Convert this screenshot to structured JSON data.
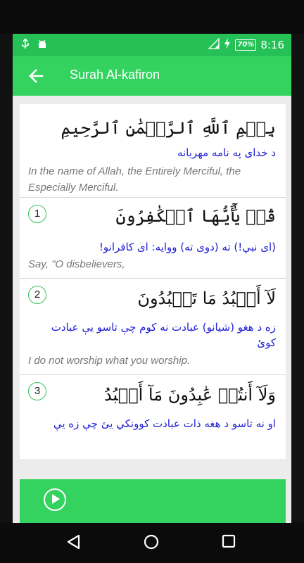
{
  "status_bar": {
    "battery": "70%",
    "time": "8:16"
  },
  "app_bar": {
    "title": "Surah Al-kafiron"
  },
  "bismillah": {
    "arabic": "بِسۡمِ ٱللَّهِ ٱلرَّحۡمَٰنِ ٱلرَّحِيمِ",
    "pashto": "د خدای په نامه مهربانه",
    "english": "In the name of Allah, the Entirely Merciful, the Especially Merciful."
  },
  "verses": [
    {
      "number": "1",
      "arabic": "قُلۡ يَٰٓأَيُّهَا ٱلۡكَٰفِرُونَ",
      "pashto": "(ای نبي!) ته (دوی ته) ووایه: ای کافرانو!",
      "english": "Say, \"O disbelievers,"
    },
    {
      "number": "2",
      "arabic": "لَآ أَعۡبُدُ مَا تَعۡبُدُونَ",
      "pashto": "زه د هغو (شیانو) عبادت نه کوم چې تاسو يې عبادت کوئ",
      "english": "I do not worship what you worship."
    },
    {
      "number": "3",
      "arabic": "وَلَآ أَنتُمۡ عَٰبِدُونَ مَآ أَعۡبُدُ",
      "pashto": "او نه تاسو د هغه ذات عبادت کوونکي يئ چې زه يې",
      "english": ""
    }
  ],
  "icons": {
    "back": "arrow-left-icon",
    "play": "play-circle-icon",
    "nav_back": "triangle-back-icon",
    "nav_home": "circle-home-icon",
    "nav_recent": "square-recent-icon"
  },
  "colors": {
    "accent": "#34d35f",
    "status_bar": "#26c156",
    "translation": "#2020d6"
  }
}
